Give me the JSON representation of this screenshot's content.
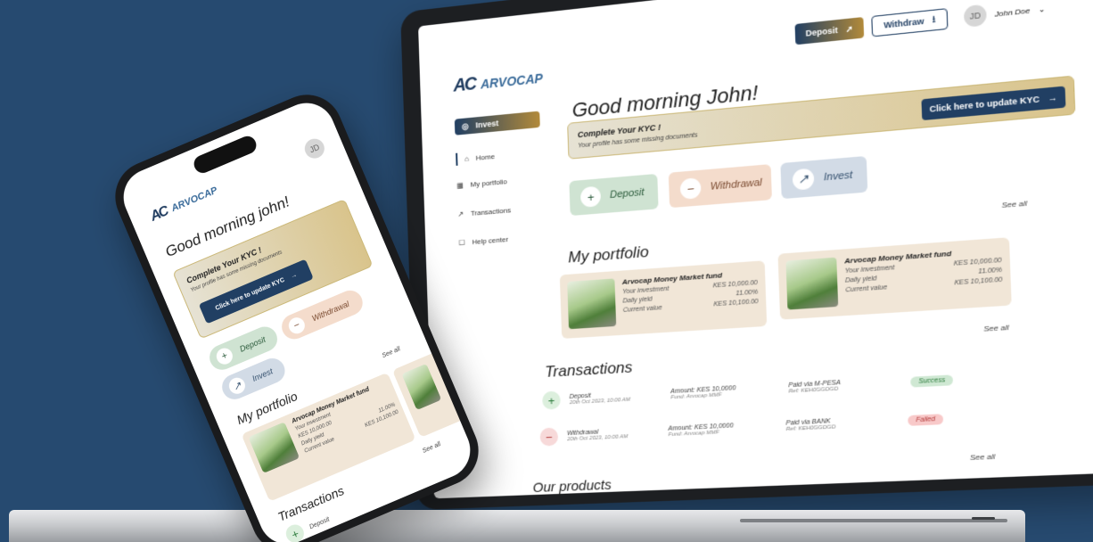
{
  "brand": {
    "mark": "AC",
    "name": "ARVOCAP"
  },
  "header": {
    "deposit_label": "Deposit",
    "withdraw_label": "Withdraw",
    "user_name": "John Doe",
    "avatar_initials": "JD"
  },
  "sidebar": {
    "invest_label": "Invest",
    "items": [
      {
        "label": "Home",
        "icon": "home-icon"
      },
      {
        "label": "My portfolio",
        "icon": "portfolio-icon"
      },
      {
        "label": "Transactions",
        "icon": "transactions-icon"
      },
      {
        "label": "Help center",
        "icon": "help-icon"
      }
    ]
  },
  "greeting": "Good morning John!",
  "phone_greeting": "Good morning john!",
  "kyc": {
    "title": "Complete Your KYC !",
    "subtitle": "Your profile has some missing documents",
    "button_label": "Click here to update KYC"
  },
  "actions": {
    "deposit": "Deposit",
    "withdrawal": "Withdrawal",
    "invest": "Invest"
  },
  "portfolio": {
    "title": "My portfolio",
    "see_all": "See all",
    "cards": [
      {
        "name": "Arvocap Money Market fund",
        "investment_label": "Your investment",
        "investment": "KES 10,000.00",
        "yield_label": "Daily yield",
        "yield": "11.00%",
        "current_label": "Current value",
        "current": "KES 10,100.00"
      },
      {
        "name": "Arvocap Money Market fund",
        "investment_label": "Your investment",
        "investment": "KES 10,000.00",
        "yield_label": "Daily yield",
        "yield": "11.00%",
        "current_label": "Current value",
        "current": "KES 10,100.00"
      }
    ]
  },
  "transactions": {
    "title": "Transactions",
    "see_all": "See all",
    "rows": [
      {
        "type": "Deposit",
        "date": "20th Oct 2023, 10:00 AM",
        "amount": "Amount: KES 10,0000",
        "fund": "Fund: Arvocap MMF",
        "method": "Paid via M-PESA",
        "ref": "Ref: KEH0GGDGD",
        "status": "Success"
      },
      {
        "type": "Withdrawal",
        "date": "20th Oct 2023, 10:00 AM",
        "amount": "Amount: KES 10,0000",
        "fund": "Fund: Arvocap MMF",
        "method": "Paid via BANK",
        "ref": "Ref: KEH0GGDGD",
        "status": "Failed"
      }
    ]
  },
  "products": {
    "title": "Our products",
    "see_all": "See all"
  },
  "phone": {
    "fund_name": "Arvocap Money Market fund",
    "investment_label": "Your investment",
    "investment": "KES 10,000.00",
    "yield_label": "Daily yield",
    "yield": "11.00%",
    "current_label": "Current value",
    "current": "KES 10,100.00",
    "tx_first": "Deposit"
  },
  "colors": {
    "background": "#264a70",
    "primary": "#213f63",
    "gold": "#b28a3a",
    "success": "#cfe3d2",
    "failed": "#f8c9c9"
  }
}
